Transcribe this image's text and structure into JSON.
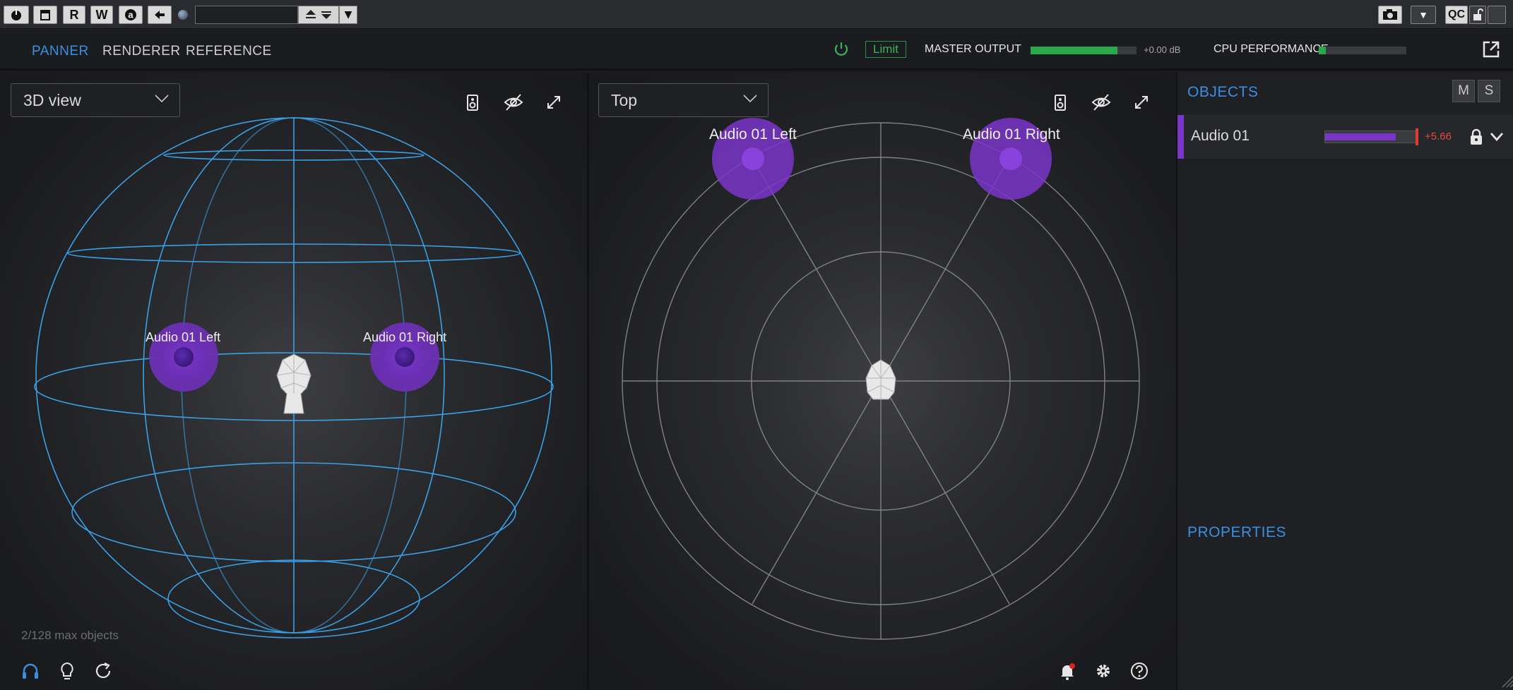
{
  "host_toolbar": {
    "buttons": {
      "power": "⏻",
      "bypass": "⧉",
      "read": "R",
      "write": "W",
      "auto": "a",
      "back": "◀",
      "dropdown": "▼",
      "camera": "📷",
      "qc": "QC"
    },
    "preset_value": ""
  },
  "header": {
    "tabs": [
      {
        "label": "PANNER",
        "active": true
      },
      {
        "label": "RENDERER",
        "active": false
      },
      {
        "label": "REFERENCE",
        "active": false
      }
    ],
    "limit_label": "Limit",
    "master_output_label": "MASTER OUTPUT",
    "master_output_db": "+0.00 dB",
    "master_output_level": 0.82,
    "cpu_label": "CPU PERFORMANCE",
    "cpu_level": 0.08,
    "colors": {
      "accent": "#3a8fe0",
      "meter": "#2aa84a",
      "object": "#7a35c9",
      "limit": "#3bb35a"
    }
  },
  "view_3d": {
    "view_select": "3D view",
    "objects": [
      {
        "label": "Audio 01 Left"
      },
      {
        "label": "Audio 01 Right"
      }
    ],
    "object_count": "2/128 max objects"
  },
  "view_top": {
    "view_select": "Top",
    "objects": [
      {
        "label": "Audio 01 Left"
      },
      {
        "label": "Audio 01 Right"
      }
    ]
  },
  "right_panel": {
    "objects_title": "OBJECTS",
    "mute_label": "M",
    "solo_label": "S",
    "object_row": {
      "name": "Audio 01",
      "level": 0.78,
      "db": "+5.66"
    },
    "properties_title": "PROPERTIES"
  },
  "icons": {
    "view_icons": [
      "speaker-icon",
      "hide-icon",
      "expand-icon"
    ],
    "footer_left": [
      "headphones-icon",
      "lightbulb-icon",
      "refresh-icon"
    ],
    "footer_right": [
      "notification-icon",
      "settings-icon",
      "help-icon"
    ]
  }
}
